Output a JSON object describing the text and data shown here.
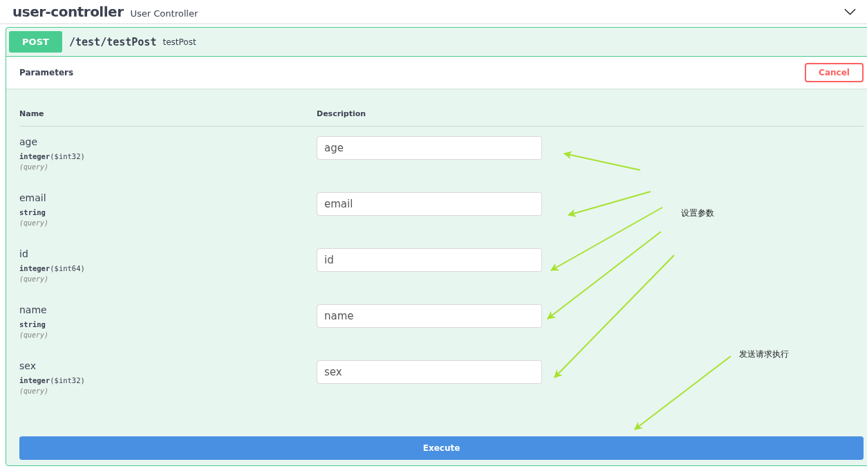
{
  "tag": {
    "name": "user-controller",
    "description": "User Controller",
    "expanded": true
  },
  "operation": {
    "method": "POST",
    "path": "/test/testPost",
    "summary": "testPost"
  },
  "parameters_section": {
    "title": "Parameters",
    "cancel_button": "Cancel"
  },
  "table": {
    "columns": [
      "Name",
      "Description"
    ],
    "rows": [
      {
        "name": "age",
        "type": "integer",
        "format": "($int32)",
        "location": "(query)",
        "placeholder": "age"
      },
      {
        "name": "email",
        "type": "string",
        "location": "(query)",
        "placeholder": "email"
      },
      {
        "name": "id",
        "type": "integer",
        "format": "($int64)",
        "location": "(query)",
        "placeholder": "id"
      },
      {
        "name": "name",
        "type": "string",
        "location": "(query)",
        "placeholder": "name"
      },
      {
        "name": "sex",
        "type": "integer",
        "format": "($int32)",
        "location": "(query)",
        "placeholder": "sex"
      }
    ]
  },
  "execute_button": "Execute",
  "annotations": [
    {
      "text": "设置参数"
    },
    {
      "text": "发送请求执行"
    }
  ]
}
